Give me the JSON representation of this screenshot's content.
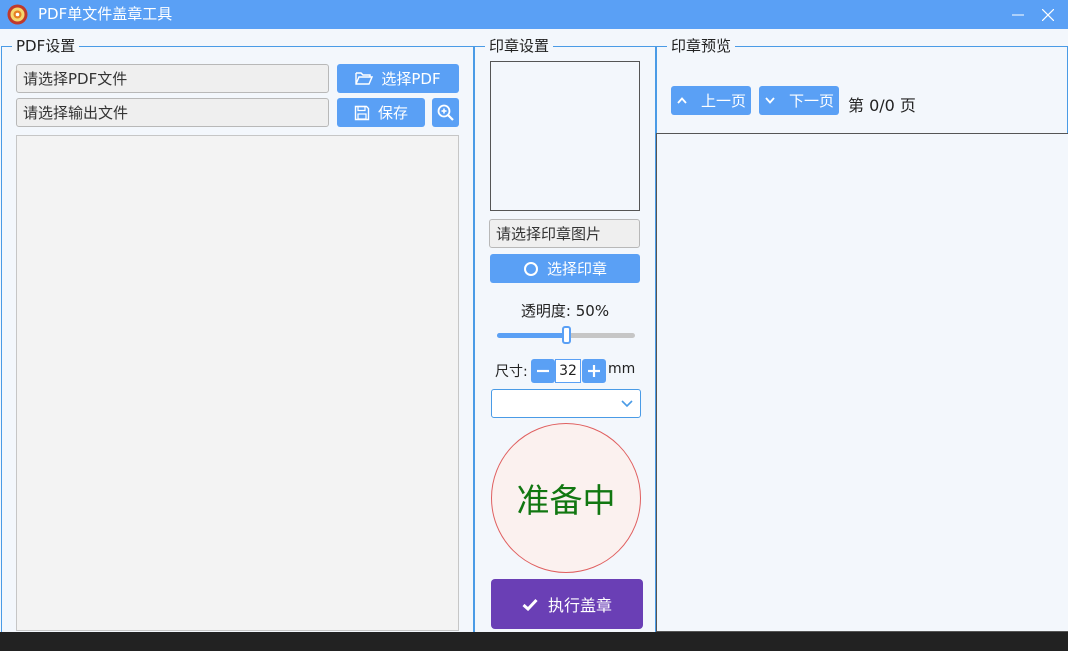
{
  "window": {
    "title": "PDF单文件盖章工具",
    "minimize_glyph": "—",
    "close_glyph": "✕"
  },
  "pdf_panel": {
    "legend": "PDF设置",
    "pdf_file_placeholder": "请选择PDF文件",
    "select_pdf_label": "选择PDF",
    "output_file_placeholder": "请选择输出文件",
    "save_label": "保存"
  },
  "stamp_panel": {
    "legend": "印章设置",
    "stamp_image_placeholder": "请选择印章图片",
    "select_stamp_label": "选择印章",
    "opacity_label": "透明度: 50%",
    "opacity_value": 0.5,
    "size_label": "尺寸:",
    "size_value": "32",
    "size_unit": "mm",
    "select_value": "",
    "status_text": "准备中",
    "execute_label": "执行盖章"
  },
  "preview_panel": {
    "legend": "印章预览",
    "prev_label": "上一页",
    "next_label": "下一页",
    "page_indicator": "第 0/0 页"
  },
  "colors": {
    "accent": "#5aa0f5",
    "execute": "#6a3fb5",
    "status_text": "#117711",
    "status_border": "#e06060"
  },
  "icons": [
    "app-logo-icon",
    "folder-open-icon",
    "save-icon",
    "zoom-in-icon",
    "circle-icon",
    "chevron-down-icon",
    "check-icon",
    "chevron-up-icon",
    "minus-icon",
    "plus-icon"
  ]
}
